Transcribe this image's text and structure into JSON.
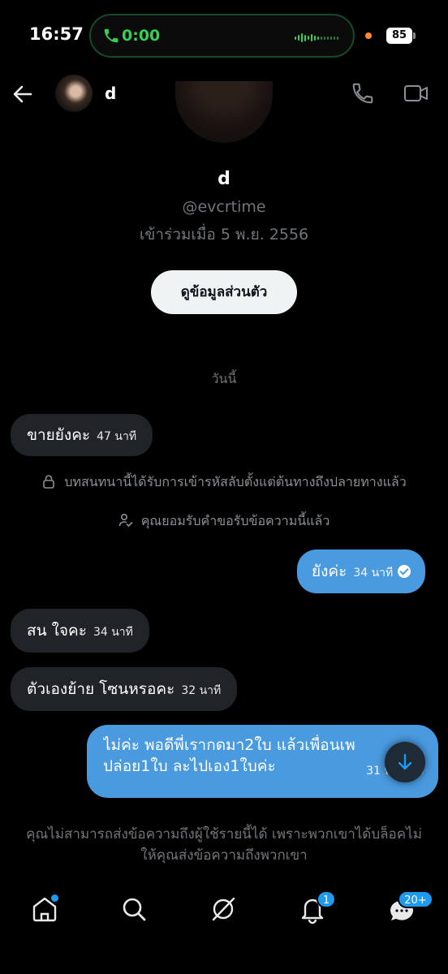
{
  "status_bar": {
    "time": "16:57",
    "call_timer": "0:00",
    "battery": "85"
  },
  "header": {
    "name": "d"
  },
  "profile": {
    "name": "d",
    "handle": "@evcrtime",
    "joined": "เข้าร่วมเมื่อ 5 พ.ย. 2556",
    "view_profile_label": "ดูข้อมูลส่วนตัว"
  },
  "date_separator": "วันนี้",
  "messages": [
    {
      "text": "ขายยังคะ",
      "time": "47 นาที"
    },
    {
      "text": "ยังค่ะ",
      "time": "34 นาที"
    },
    {
      "text": "สน ใจคะ",
      "time": "34 นาที"
    },
    {
      "text": "ตัวเองย้าย โซนหรอคะ",
      "time": "32 นาที"
    },
    {
      "line1": "ไม่ค่ะ พอดีพี่เรากดมา2ใบ แล้วเพื่อนเพ",
      "line2": "ปล่อย1ใบ ละไปเอง1ใบค่ะ",
      "time": "31 นาที"
    }
  ],
  "system_notices": {
    "encrypted": "บทสนทนานี้ได้รับการเข้ารหัสลับตั้งแต่ต้นทางถึงปลายทางแล้ว",
    "accepted": "คุณยอมรับคำขอรับข้อความนี้แล้ว"
  },
  "blocked_note": "คุณไม่สามารถส่งข้อความถึงผู้ใช้รายนี้ได้ เพราะพวกเขาได้บล็อคไม่ ให้คุณส่งข้อความถึงพวกเขา",
  "tabs": {
    "notifications_badge": "1",
    "messages_badge": "20+"
  },
  "colors": {
    "accent": "#1d9bf0",
    "outgoing_bubble": "#4a9ae0",
    "incoming_bubble": "#202327"
  },
  "icons": [
    "back-arrow-icon",
    "phone-icon",
    "video-icon",
    "lock-icon",
    "person-check-icon",
    "arrow-down-icon",
    "home-icon",
    "search-icon",
    "grok-icon",
    "bell-icon",
    "mail-icon"
  ]
}
